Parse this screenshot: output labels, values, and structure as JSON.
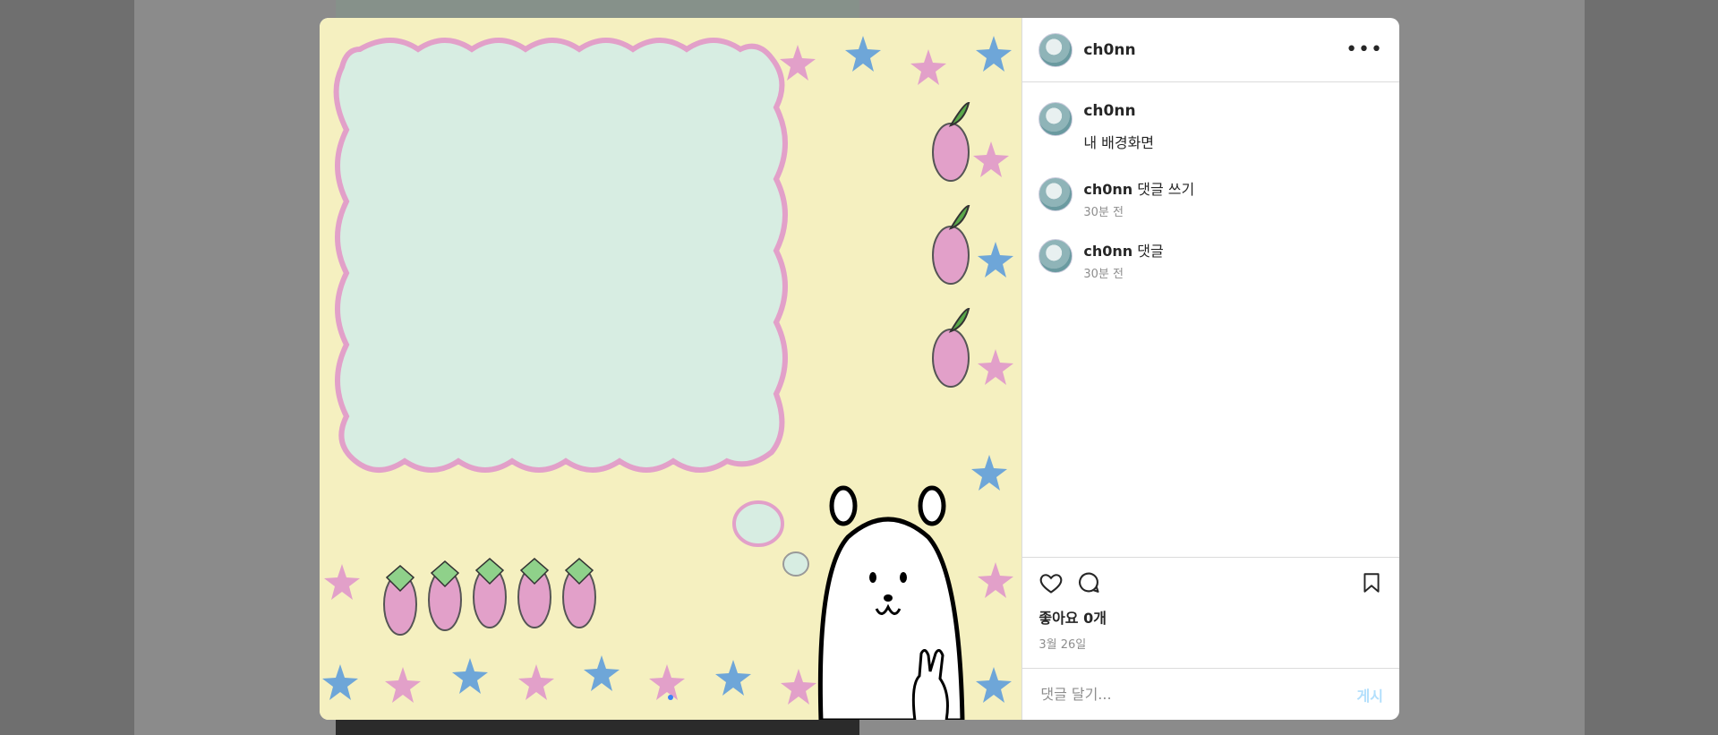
{
  "post": {
    "username": "ch0nn",
    "more_icon": "ellipsis-icon",
    "caption": "내 배경화면",
    "comments": [
      {
        "username": "ch0nn",
        "text": "댓글 쓰기",
        "time": "30분 전"
      },
      {
        "username": "ch0nn",
        "text": "댓글",
        "time": "30분 전"
      }
    ],
    "likes": "좋아요 0개",
    "date": "3월 26일",
    "comment_placeholder": "댓글 달기...",
    "post_label": "게시"
  },
  "colors": {
    "background": "#f5f0c0",
    "cloud_fill": "#d7ede2",
    "cloud_border": "#e2a0c9",
    "pink": "#e2a0c9",
    "blue": "#6ea6d8",
    "post_button": "#b2dffc"
  }
}
